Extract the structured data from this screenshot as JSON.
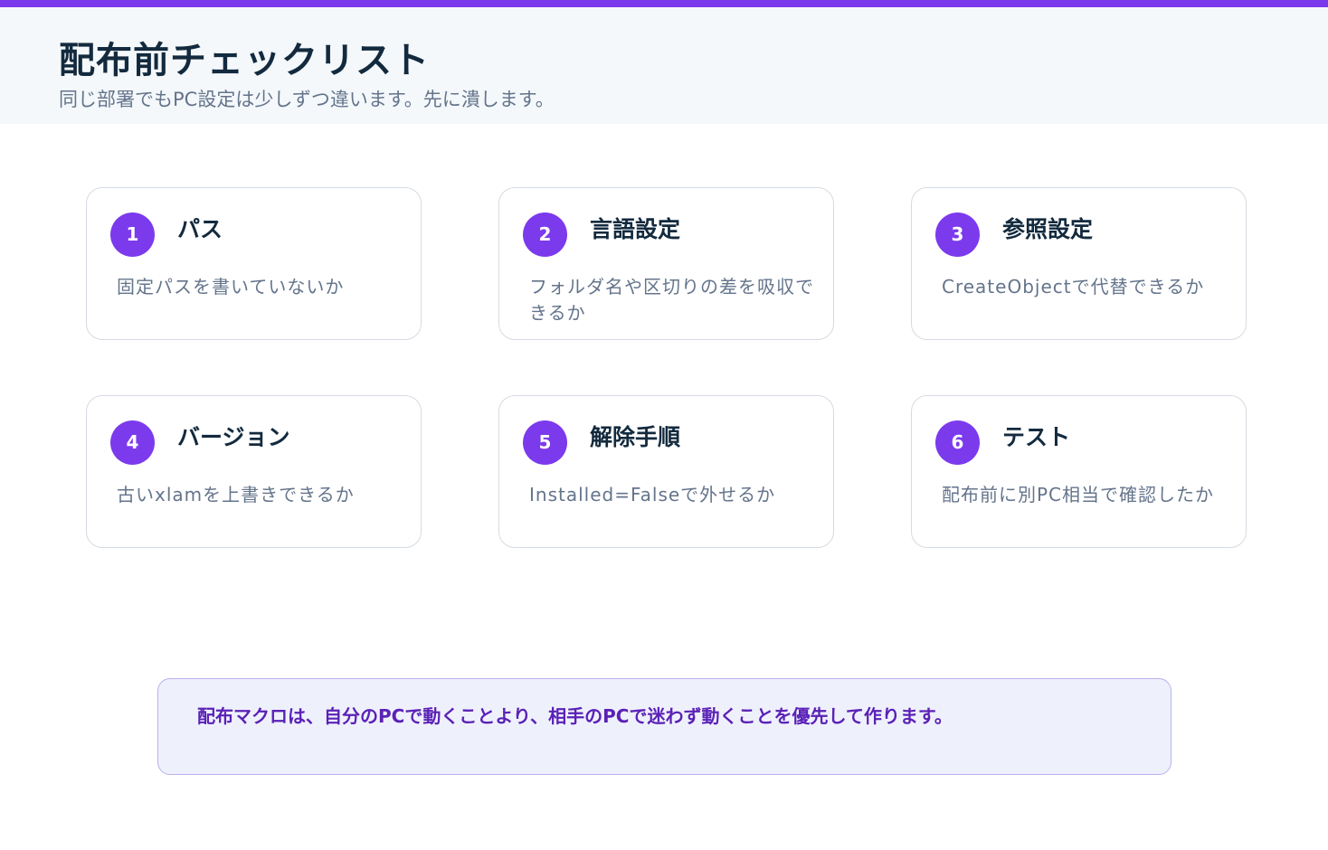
{
  "header": {
    "title": "配布前チェックリスト",
    "subtitle": "同じ部署でもPC設定は少しずつ違います。先に潰します。"
  },
  "cards": [
    {
      "number": "1",
      "title": "パス",
      "description": "固定パスを書いていないか"
    },
    {
      "number": "2",
      "title": "言語設定",
      "description": "フォルダ名や区切りの差を吸収できるか"
    },
    {
      "number": "3",
      "title": "参照設定",
      "description": "CreateObjectで代替できるか"
    },
    {
      "number": "4",
      "title": "バージョン",
      "description": "古いxlamを上書きできるか"
    },
    {
      "number": "5",
      "title": "解除手順",
      "description": "Installed=Falseで外せるか"
    },
    {
      "number": "6",
      "title": "テスト",
      "description": "配布前に別PC相当で確認したか"
    }
  ],
  "note": {
    "text": "配布マクロは、自分のPCで動くことより、相手のPCで迷わず動くことを優先して作ります。"
  },
  "colors": {
    "accent": "#7c3aed",
    "title_text": "#132a3e",
    "muted_text": "#64748b",
    "header_bg": "#f4f8fb",
    "note_bg": "#eef1fc",
    "note_text": "#5b21b6"
  }
}
